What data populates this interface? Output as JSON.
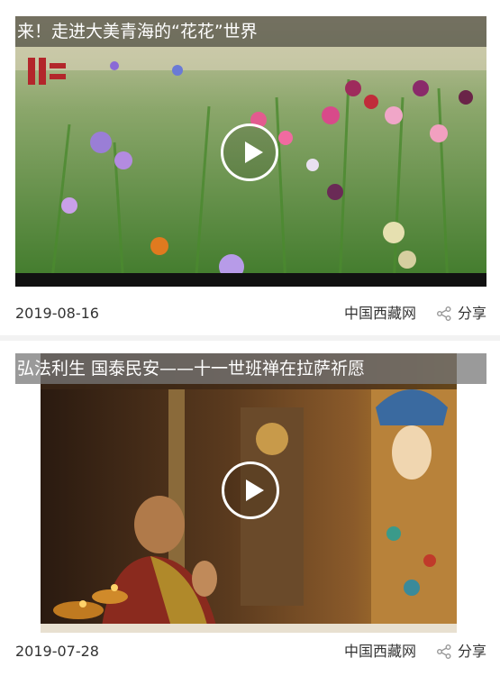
{
  "items": [
    {
      "title": "来！走进大美青海的“花花”世界",
      "date": "2019-08-16",
      "source": "中国西藏网",
      "share_label": "分享"
    },
    {
      "title": "弘法利生 国泰民安——十一世班禅在拉萨祈愿",
      "date": "2019-07-28",
      "source": "中国西藏网",
      "share_label": "分享"
    }
  ]
}
